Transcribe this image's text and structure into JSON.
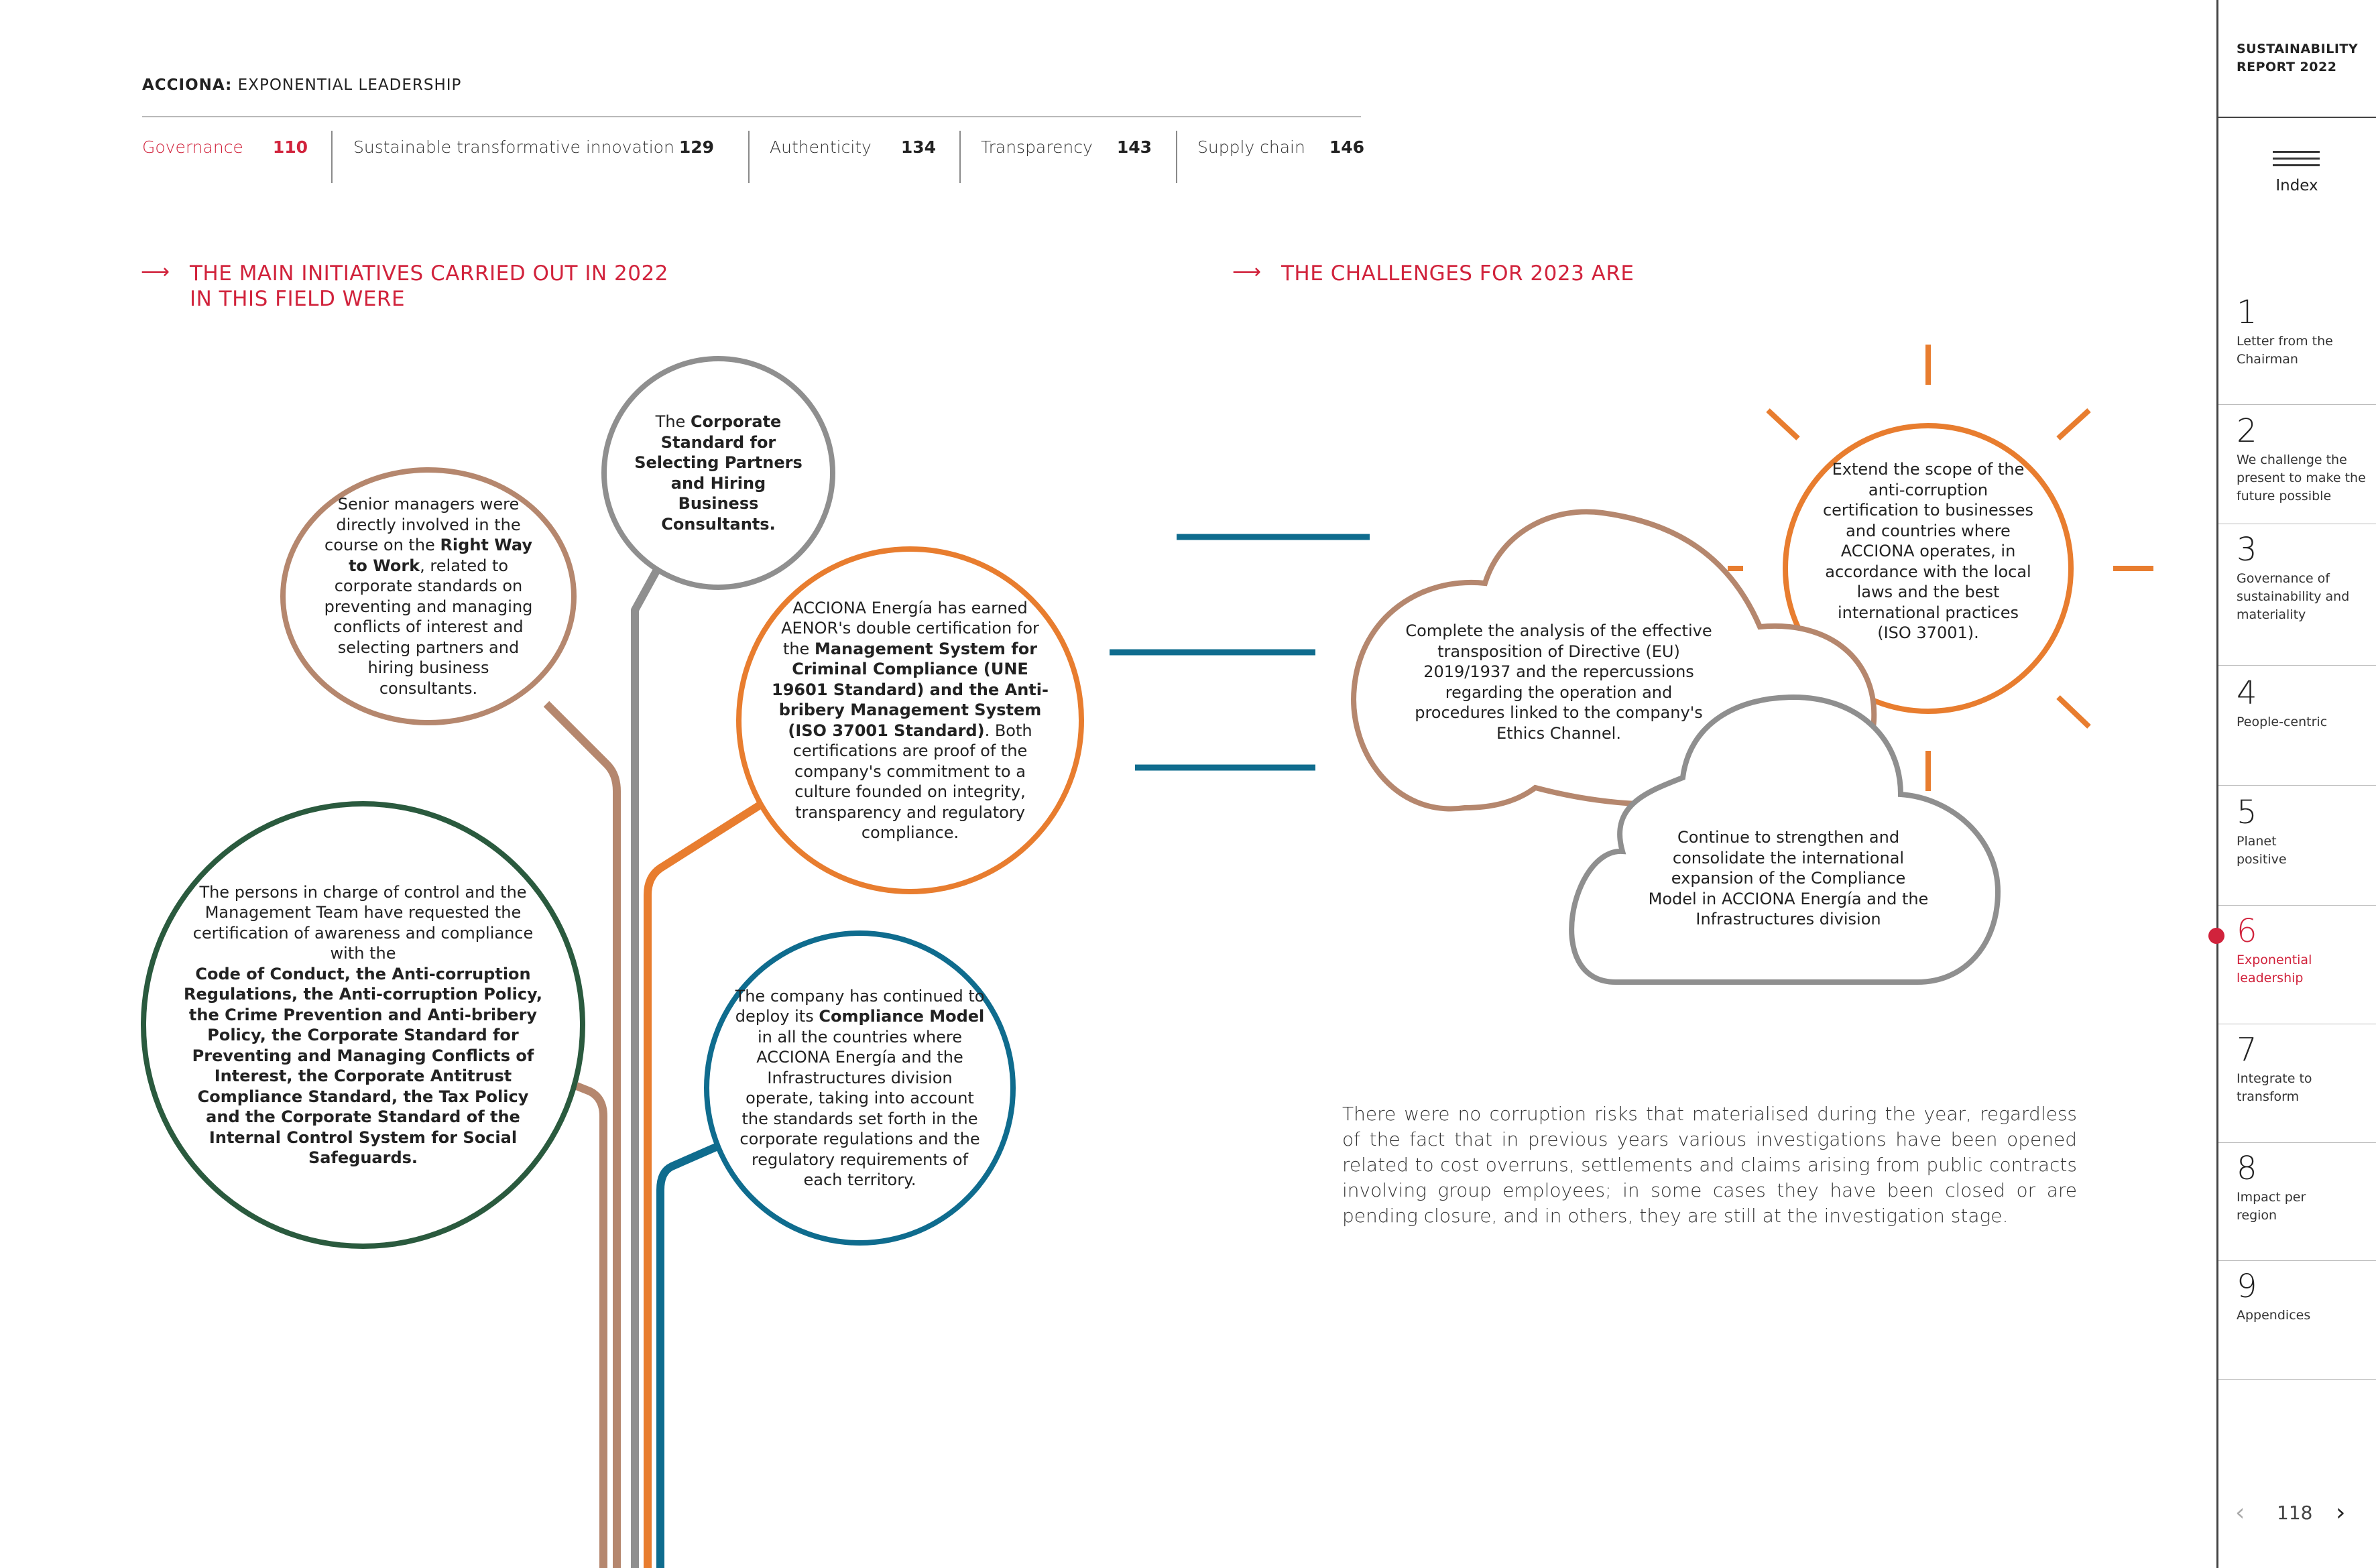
{
  "header": {
    "brand_bold": "ACCIONA:",
    "brand_rest": " EXPONENTIAL LEADERSHIP",
    "nav": [
      {
        "label": "Governance",
        "page": "110"
      },
      {
        "label": "Sustainable transformative innovation",
        "page": "129"
      },
      {
        "label": "Authenticity",
        "page": "134"
      },
      {
        "label": "Transparency",
        "page": "143"
      },
      {
        "label": "Supply chain",
        "page": "146"
      }
    ]
  },
  "left_section": {
    "heading_line1": "THE MAIN INITIATIVES CARRIED OUT IN 2022",
    "heading_line2": "IN THIS FIELD WERE",
    "arrow": "⟶"
  },
  "right_section": {
    "heading": "THE CHALLENGES FOR 2023 ARE",
    "arrow": "⟶"
  },
  "initiatives": {
    "senior": {
      "t1": "Senior managers were directly involved in the course on the ",
      "b1": "Right Way to Work",
      "t2": ", related to corporate standards on preventing and managing conflicts of interest and selecting partners and hiring business consultants."
    },
    "corporate_std": {
      "t1": "The ",
      "b1": "Corporate Standard for Selecting Partners and Hiring Business Consultants."
    },
    "aenor": {
      "t1": "ACCIONA Energía has earned AENOR's double certification for the ",
      "b1": "Management System for Criminal Compliance (UNE 19601 Standard) and the Anti-bribery Management System (ISO 37001 Standard)",
      "t2": ". Both certifications are proof of the company's commitment to a culture founded on integrity, transparency and regulatory compliance."
    },
    "persons": {
      "t1": "The persons in charge of control and the Management Team have requested the certification of awareness and compliance with the",
      "b1": "Code of Conduct, the Anti-corruption Regulations, the Anti-corruption Policy, the Crime Prevention and Anti-bribery Policy, the Corporate Standard for Preventing and Managing Conflicts of Interest, the Corporate Antitrust Compliance Standard, the Tax Policy and the Corporate Standard of the Internal Control System for Social Safeguards."
    },
    "model": {
      "t1": "The company has continued to deploy its ",
      "b1": "Compliance Model",
      "t2": " in all the countries where ACCIONA Energía and the Infrastructures division operate, taking into account the standards set forth in the corporate regulations and the regulatory requirements of each territory."
    }
  },
  "challenges": {
    "extend": "Extend the scope of the anti-corruption certification to businesses and countries where ACCIONA operates, in accordance with the local laws and the best international practices (ISO 37001).",
    "analysis": "Complete the analysis of the effective transposition of Directive (EU) 2019/1937 and the repercussions regarding the operation and procedures linked to the company's Ethics Channel.",
    "strengthen": "Continue to strengthen and consolidate the international expansion of the Compliance Model in ACCIONA Energía and the Infrastructures division"
  },
  "paragraph": "There were no corruption risks that materialised during the year, regardless of the fact that in previous years various investigations have been opened related to cost overruns, settlements and claims arising from public contracts involving group employees; in some cases they have been closed or are pending closure, and in others, they are still at the investigation stage.",
  "sidebar": {
    "report_title_l1": "SUSTAINABILITY",
    "report_title_l2": "REPORT 2022",
    "index_label": "Index",
    "chapters": [
      {
        "num": "1",
        "title": "Letter from the Chairman"
      },
      {
        "num": "2",
        "title": "We challenge the present to make the future possible"
      },
      {
        "num": "3",
        "title": "Governance of sustainability and materiality"
      },
      {
        "num": "4",
        "title": "People-centric"
      },
      {
        "num": "5",
        "title": "Planet positive"
      },
      {
        "num": "6",
        "title": "Exponential leadership"
      },
      {
        "num": "7",
        "title": "Integrate to transform"
      },
      {
        "num": "8",
        "title": "Impact per region"
      },
      {
        "num": "9",
        "title": "Appendices"
      }
    ],
    "page_number": "118",
    "prev": "‹",
    "next": "›"
  },
  "colors": {
    "accent_red": "#d1233c",
    "brown": "#b5876e",
    "grey": "#8f8f8f",
    "orange": "#e87d2f",
    "blue": "#0f6c8e",
    "green": "#2a5a3e"
  }
}
